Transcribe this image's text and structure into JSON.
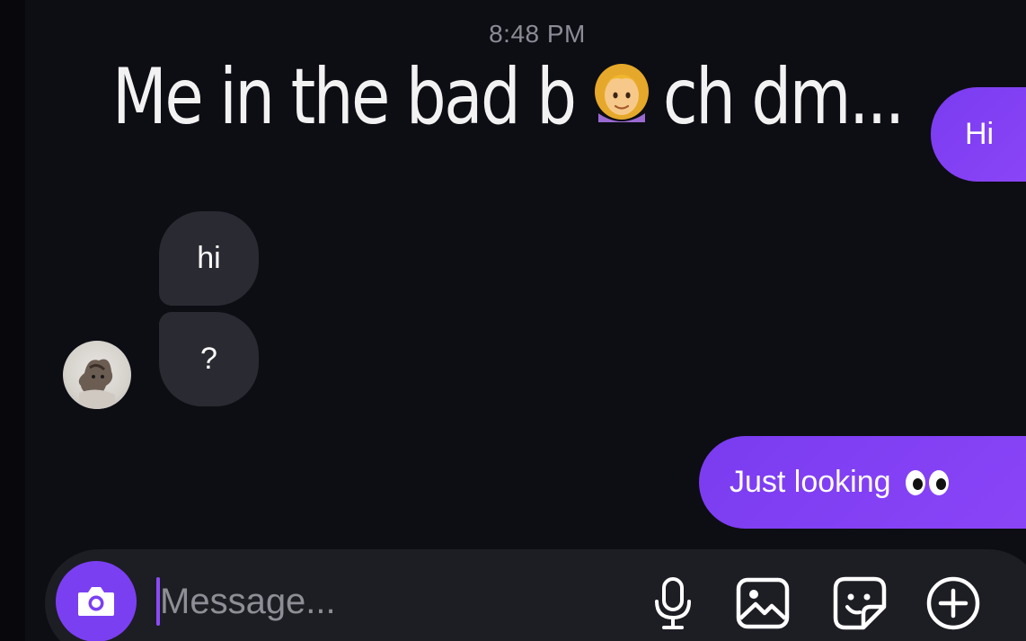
{
  "header": {
    "timestamp": "8:48 PM"
  },
  "meme_caption": {
    "text": "Me in the bad b   ch dm...",
    "emoji": "woman-emoji"
  },
  "messages": [
    {
      "id": "out-1",
      "direction": "outgoing",
      "text": "Hi"
    },
    {
      "id": "in-1",
      "direction": "incoming",
      "text": "hi"
    },
    {
      "id": "in-2",
      "direction": "incoming",
      "text": "?"
    },
    {
      "id": "out-2",
      "direction": "outgoing",
      "text": "Just looking",
      "emoji": "eyes-emoji"
    }
  ],
  "composer": {
    "placeholder": "Message...",
    "camera_icon": "camera-icon",
    "tools": [
      "microphone-icon",
      "gallery-icon",
      "sticker-icon",
      "plus-circle-icon"
    ]
  },
  "colors": {
    "background": "#0d0d14",
    "outgoing_bubble": "#7b3ff2",
    "incoming_bubble": "#2a2a32",
    "composer": "#1d1d24"
  }
}
